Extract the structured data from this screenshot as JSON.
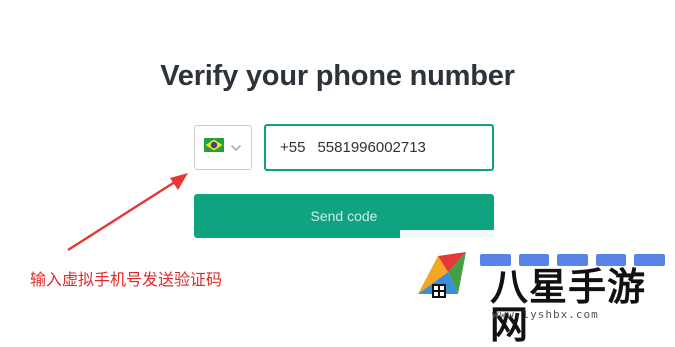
{
  "heading": "Verify your phone number",
  "country": {
    "flag_icon": "brazil-flag-icon",
    "chevron_icon": "chevron-down-icon"
  },
  "phone": {
    "country_code": "+55",
    "number": "5581996002713"
  },
  "send_button": {
    "label": "Send code"
  },
  "annotation": {
    "text": "输入虚拟手机号发送验证码",
    "color": "#e02a2a"
  },
  "watermark": {
    "brand": "八星手游网",
    "url": "www.lyshbx.com"
  },
  "colors": {
    "accent": "#10a37f",
    "heading": "#2d333a"
  }
}
